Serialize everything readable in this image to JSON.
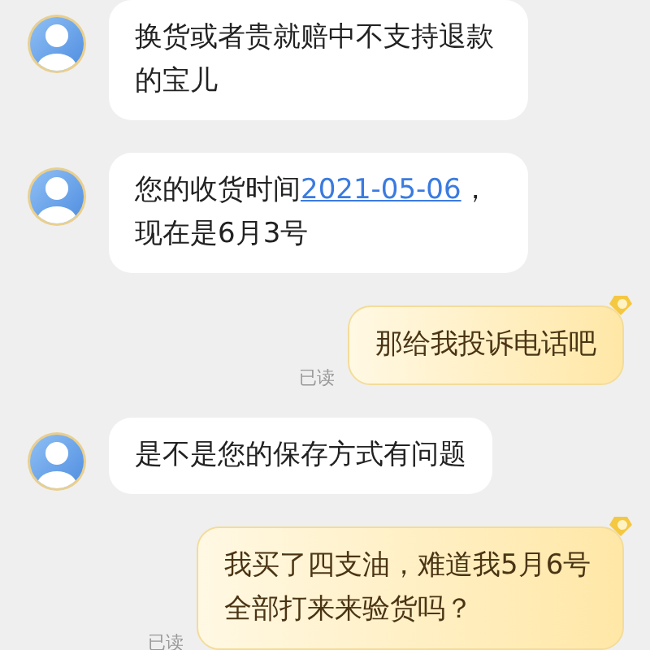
{
  "messages": [
    {
      "kind": "incoming",
      "parts": [
        {
          "kind": "text",
          "text": "换货或者贵就赔中不支持退款的宝儿"
        }
      ]
    },
    {
      "kind": "incoming",
      "parts": [
        {
          "kind": "text",
          "text": "您的收货时间"
        },
        {
          "kind": "link",
          "text": "2021-05-06"
        },
        {
          "kind": "text",
          "text": "，现在是6月3号"
        }
      ]
    },
    {
      "kind": "outgoing",
      "status": "已读",
      "parts": [
        {
          "kind": "text",
          "text": "那给我投诉电话吧"
        }
      ]
    },
    {
      "kind": "incoming",
      "parts": [
        {
          "kind": "text",
          "text": "是不是您的保存方式有问题"
        }
      ]
    },
    {
      "kind": "outgoing",
      "status": "已读",
      "parts": [
        {
          "kind": "text",
          "text": "我买了四支油，难道我5月6号全部打来来验货吗？"
        }
      ]
    }
  ]
}
